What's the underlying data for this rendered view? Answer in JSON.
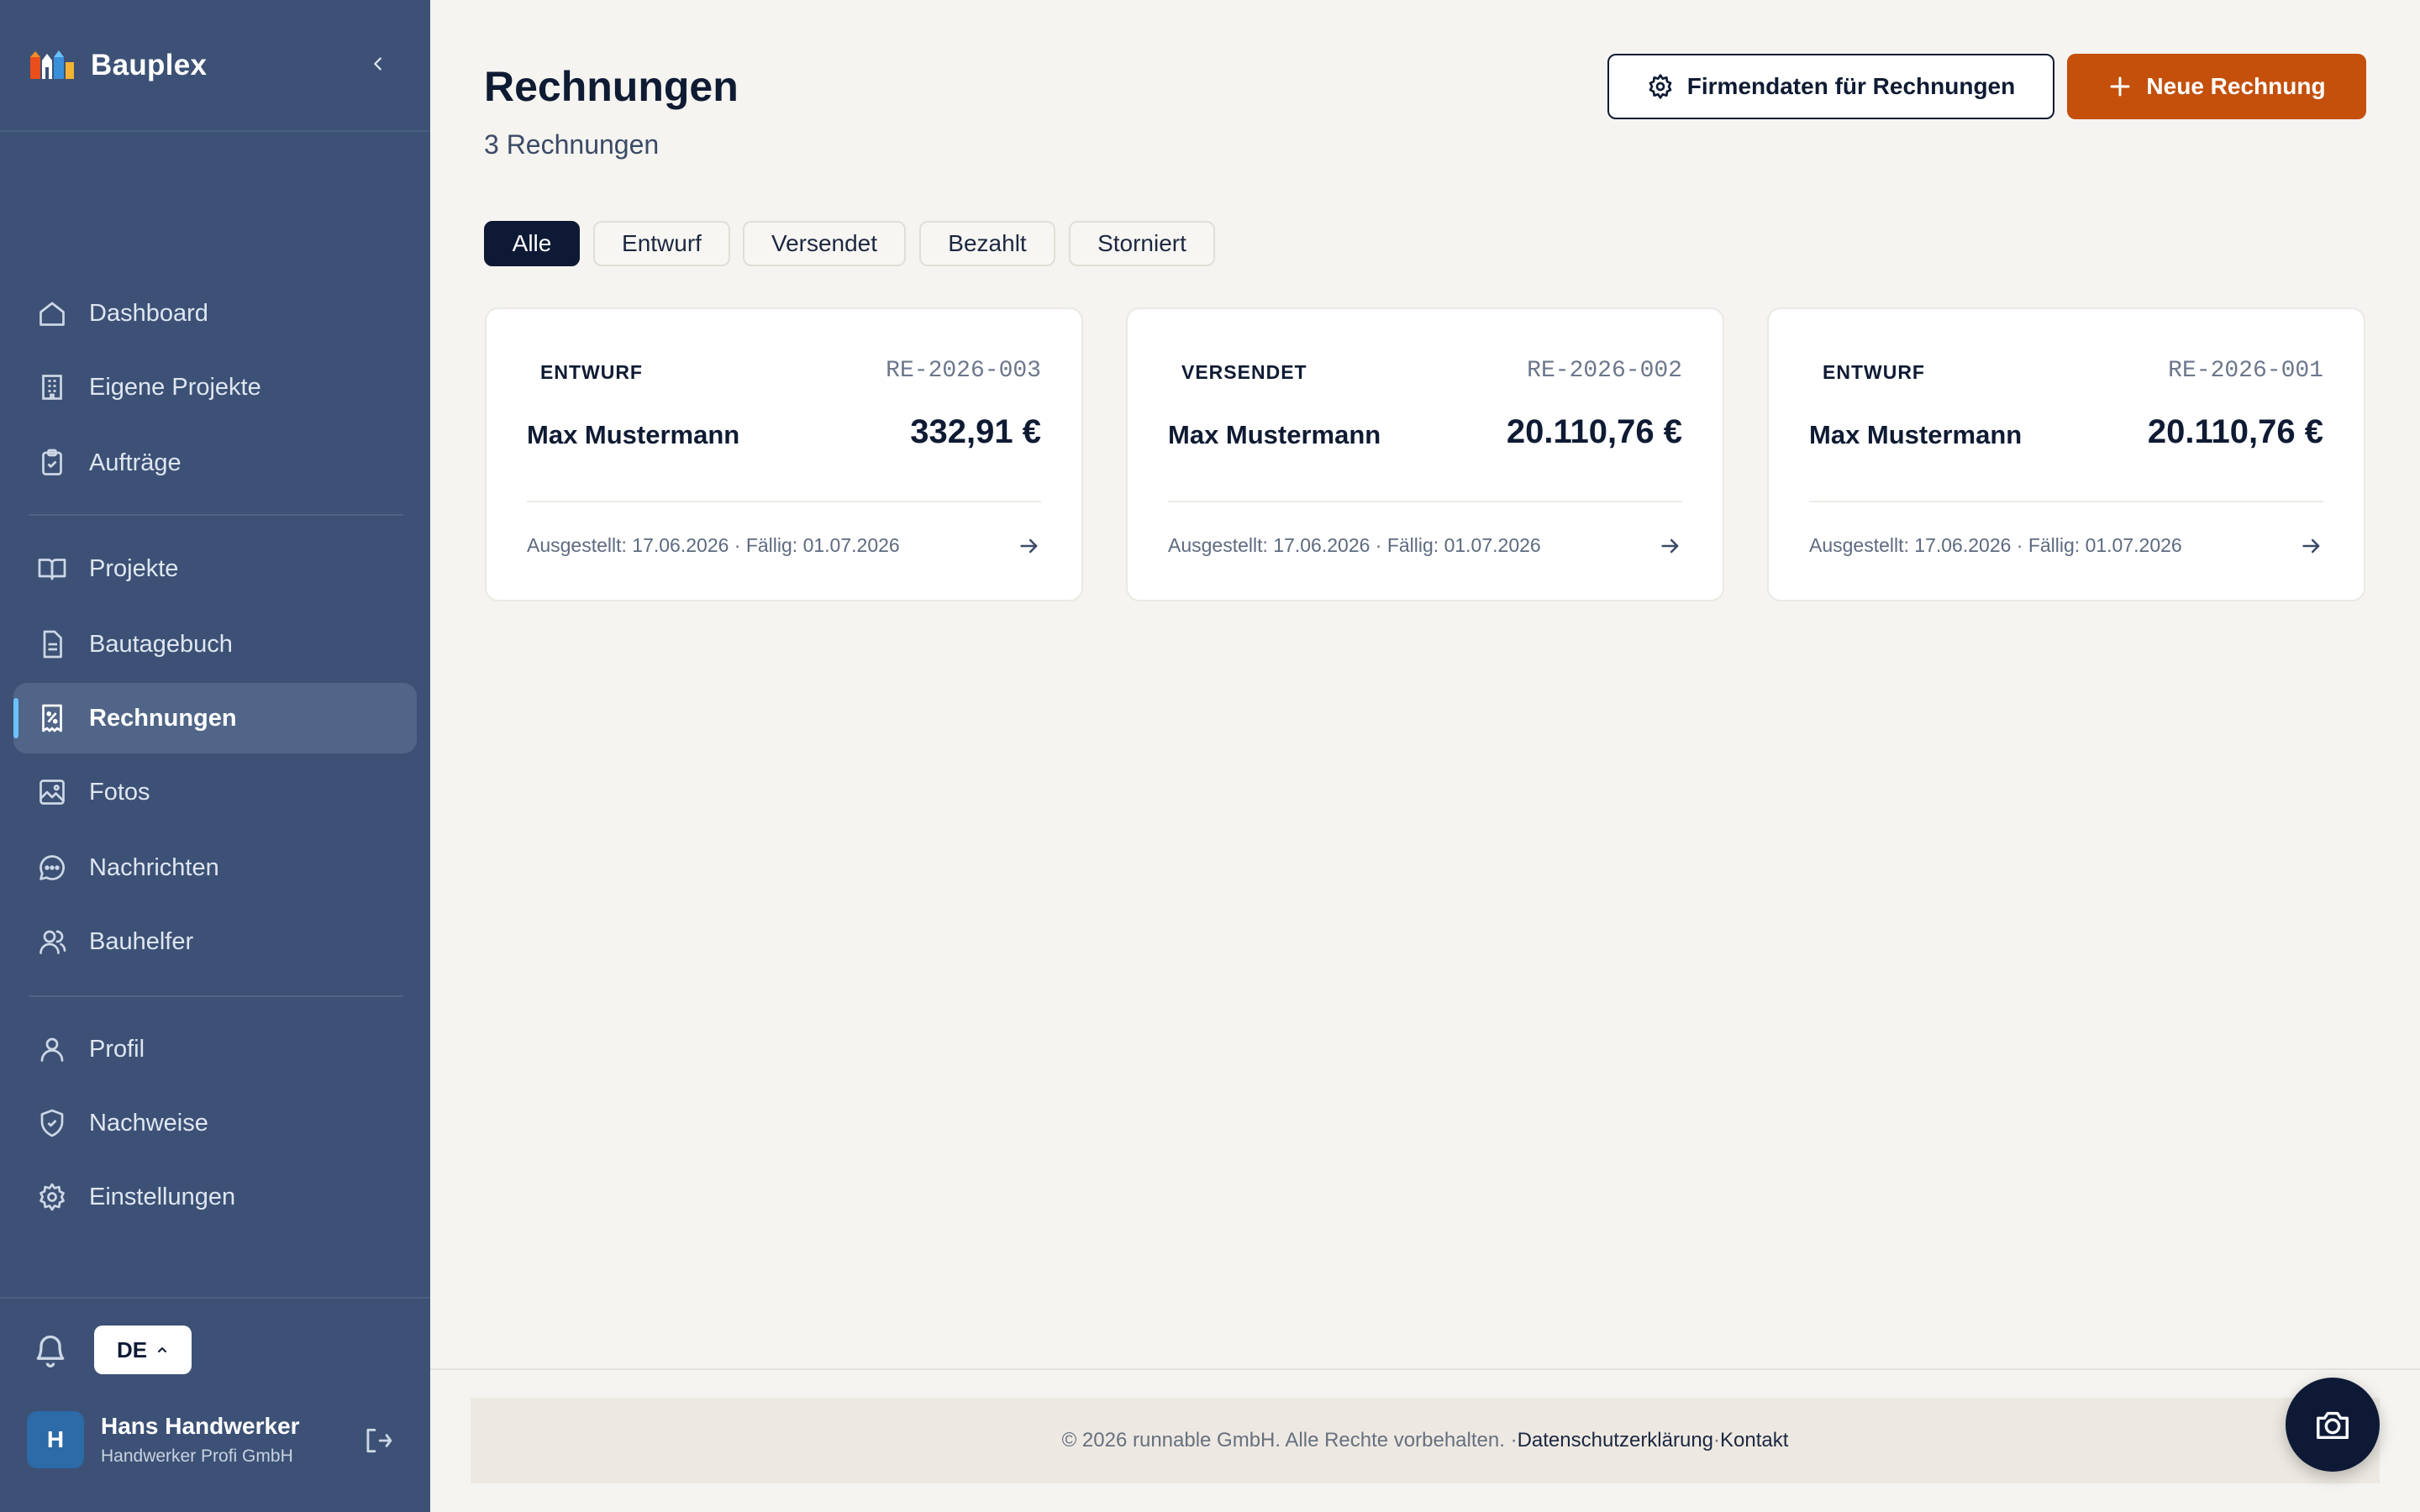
{
  "brand": {
    "name": "Bauplex"
  },
  "sidebar": {
    "items": [
      {
        "label": "Dashboard",
        "icon": "home-icon"
      },
      {
        "label": "Eigene Projekte",
        "icon": "building-icon"
      },
      {
        "label": "Aufträge",
        "icon": "clipboard-check-icon"
      },
      {
        "label": "Projekte",
        "icon": "book-open-icon"
      },
      {
        "label": "Bautagebuch",
        "icon": "file-text-icon"
      },
      {
        "label": "Rechnungen",
        "icon": "receipt-icon",
        "active": true
      },
      {
        "label": "Fotos",
        "icon": "image-icon"
      },
      {
        "label": "Nachrichten",
        "icon": "message-icon"
      },
      {
        "label": "Bauhelfer",
        "icon": "users-icon"
      },
      {
        "label": "Profil",
        "icon": "user-icon"
      },
      {
        "label": "Nachweise",
        "icon": "shield-check-icon"
      },
      {
        "label": "Einstellungen",
        "icon": "gear-icon"
      }
    ],
    "language": "DE",
    "user": {
      "initial": "H",
      "name": "Hans Handwerker",
      "company": "Handwerker Profi GmbH"
    }
  },
  "page": {
    "title": "Rechnungen",
    "count": "3 Rechnungen",
    "settings_button": "Firmendaten für Rechnungen",
    "new_button": "Neue Rechnung"
  },
  "filters": [
    "Alle",
    "Entwurf",
    "Versendet",
    "Bezahlt",
    "Storniert"
  ],
  "active_filter": "Alle",
  "invoices": [
    {
      "status": "ENTWURF",
      "number": "RE-2026-003",
      "client": "Max Mustermann",
      "amount": "332,91 €",
      "dates": "Ausgestellt: 17.06.2026 · Fällig: 01.07.2026"
    },
    {
      "status": "VERSENDET",
      "number": "RE-2026-002",
      "client": "Max Mustermann",
      "amount": "20.110,76 €",
      "dates": "Ausgestellt: 17.06.2026 · Fällig: 01.07.2026"
    },
    {
      "status": "ENTWURF",
      "number": "RE-2026-001",
      "client": "Max Mustermann",
      "amount": "20.110,76 €",
      "dates": "Ausgestellt: 17.06.2026 · Fällig: 01.07.2026"
    }
  ],
  "footer": {
    "copyright": "© 2026 runnable GmbH. Alle Rechte vorbehalten. ·",
    "privacy": "Datenschutzerklärung",
    "dot": "·",
    "contact": "Kontakt"
  },
  "colors": {
    "sidebar": "#3c5175",
    "accent": "#c4500b",
    "dark": "#0e1a35",
    "background": "#f5f4f0"
  }
}
